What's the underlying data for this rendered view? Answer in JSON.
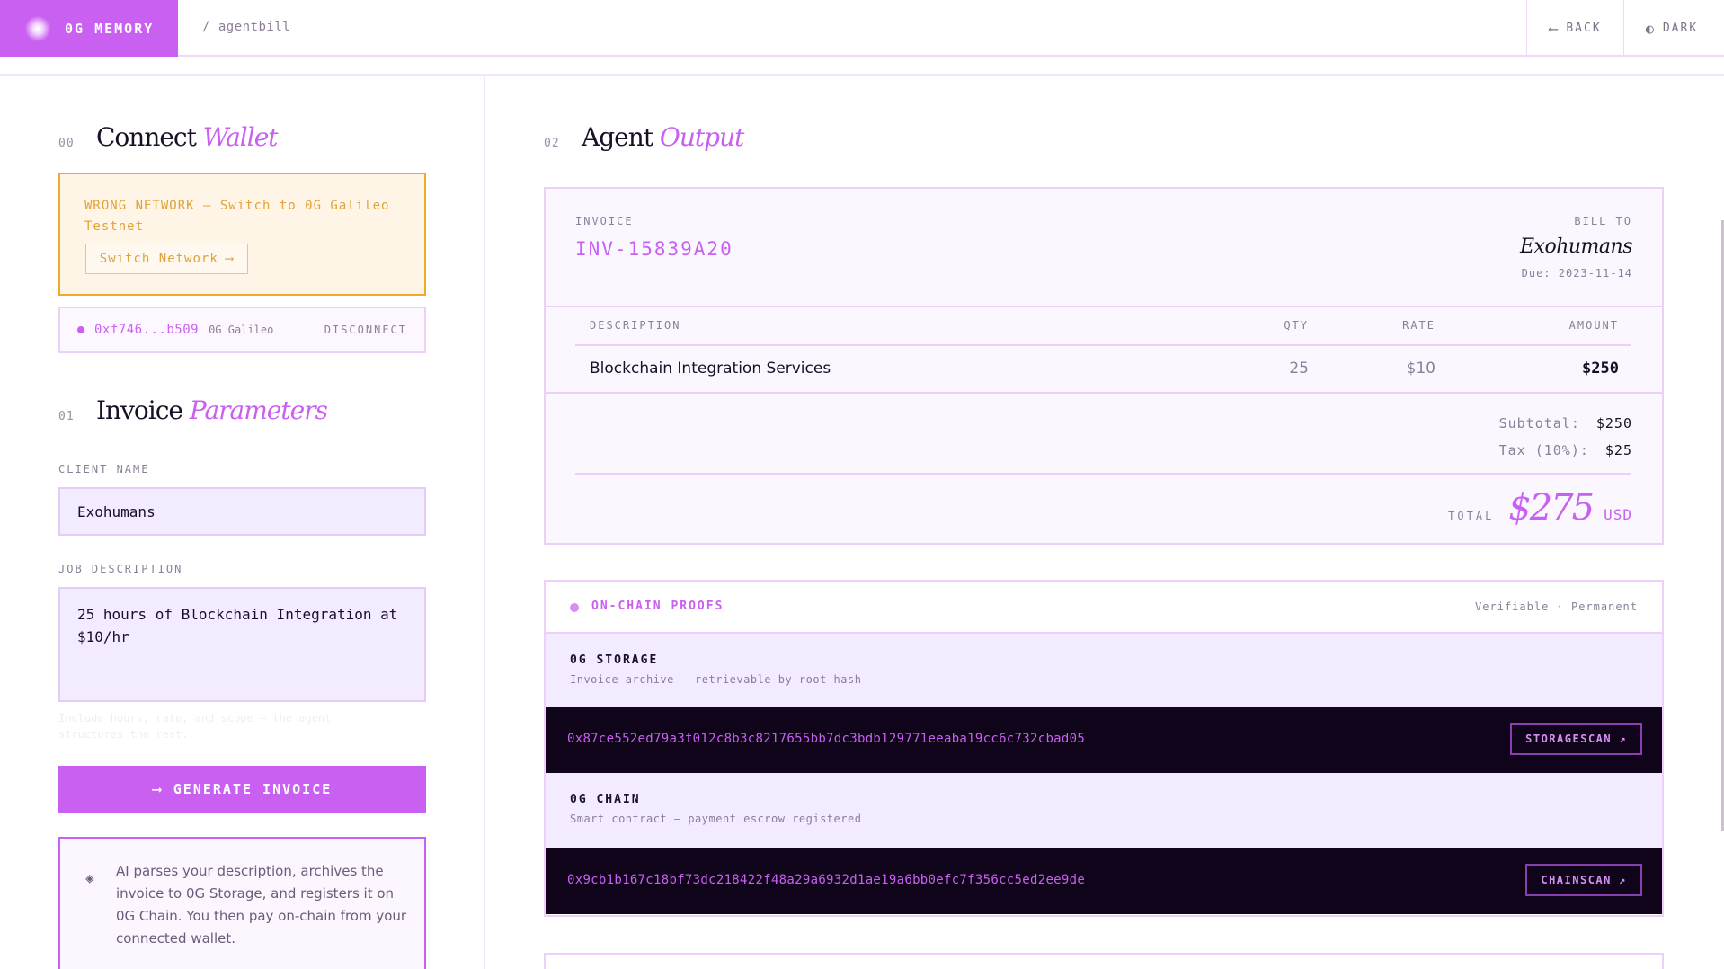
{
  "header": {
    "brand": "0G MEMORY",
    "breadcrumb": "/ agentbill",
    "back_label": "BACK",
    "dark_label": "DARK",
    "back_icon": "arrow-left-icon",
    "dark_icon": "half-circle-icon"
  },
  "connect": {
    "number": "00",
    "title_plain": "Connect",
    "title_accent": "Wallet",
    "warning_text": "WRONG NETWORK — Switch to 0G Galileo Testnet",
    "switch_label": "Switch Network",
    "wallet_address": "0xf746...b509",
    "wallet_network": "0G Galileo",
    "disconnect_label": "DISCONNECT"
  },
  "params": {
    "number": "01",
    "title_plain": "Invoice",
    "title_accent": "Parameters",
    "client_label": "CLIENT NAME",
    "client_value": "Exohumans",
    "job_label": "JOB DESCRIPTION",
    "job_value": "25 hours of Blockchain Integration at $10/hr",
    "hint": "Include hours, rate, and scope — the agent structures the rest.",
    "generate_label": "GENERATE INVOICE",
    "info_text": "AI parses your description, archives the invoice to 0G Storage, and registers it on 0G Chain. You then pay on-chain from your connected wallet."
  },
  "output": {
    "number": "02",
    "title_plain": "Agent",
    "title_accent": "Output"
  },
  "invoice": {
    "label": "INVOICE",
    "number": "INV-15839A20",
    "bill_to_label": "BILL TO",
    "bill_to_name": "Exohumans",
    "due": "Due: 2023-11-14",
    "columns": [
      "DESCRIPTION",
      "QTY",
      "RATE",
      "AMOUNT"
    ],
    "rows": [
      {
        "description": "Blockchain Integration Services",
        "qty": "25",
        "rate": "$10",
        "amount": "$250"
      }
    ],
    "subtotal_label": "Subtotal:",
    "subtotal": "$250",
    "tax_label": "Tax (10%):",
    "tax": "$25",
    "total_label": "TOTAL",
    "total": "$275",
    "currency": "USD"
  },
  "proofs": {
    "title": "ON-CHAIN PROOFS",
    "tag": "Verifiable · Permanent",
    "storage_title": "0G STORAGE",
    "storage_sub": "Invoice archive — retrievable by root hash",
    "storage_hash": "0x87ce552ed79a3f012c8b3c8217655bb7dc3bdb129771eeaba19cc6c732cbad05",
    "storage_button": "STORAGESCAN",
    "chain_title": "0G CHAIN",
    "chain_sub": "Smart contract — payment escrow registered",
    "chain_hash": "0x9cb1b167c18bf73dc218422f48a29a6932d1ae19a6bb0efc7f356cc5ed2ee9de",
    "chain_button": "CHAINSCAN"
  },
  "colors": {
    "accent": "#c960f2",
    "warning": "#f2a92b",
    "dark_bar": "#10041a"
  }
}
